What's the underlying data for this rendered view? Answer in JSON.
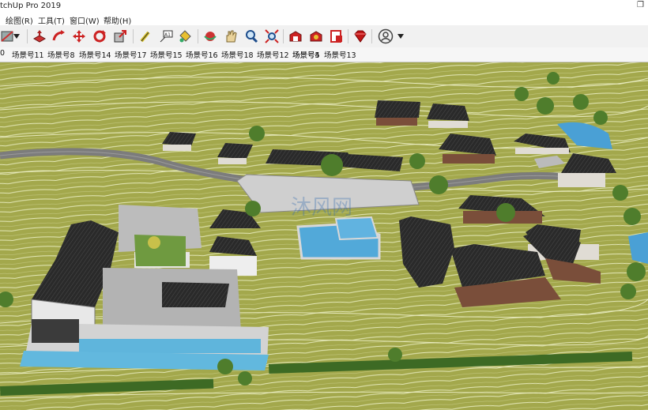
{
  "window": {
    "title": "tchUp Pro 2019",
    "restore_glyph": "❐"
  },
  "menu": {
    "items": [
      "绘图(R)",
      "工具(T)",
      "窗口(W)",
      "帮助(H)"
    ]
  },
  "toolbar": {
    "icons": [
      "paint-icon",
      "dropdown-arrow-icon",
      "push-pull-icon",
      "follow-me-icon",
      "move-icon",
      "rotate-icon",
      "scale-icon",
      "tape-measure-icon",
      "text-icon",
      "paint-bucket-icon",
      "orbit-icon",
      "pan-icon",
      "zoom-icon",
      "zoom-extents-icon",
      "warehouse-icon",
      "extension-warehouse-icon",
      "layout-icon",
      "ruby-icon",
      "account-icon",
      "account-dropdown-icon"
    ]
  },
  "scenes": {
    "tabs": [
      "0",
      "场景号11",
      "场景号8",
      "场景号14",
      "场景号17",
      "场景号15",
      "场景号16",
      "场景号18",
      "场景号12",
      "场景号5",
      "场景号4",
      "场景号13"
    ]
  },
  "viewport": {
    "watermark": "沐风网",
    "accent_colors": {
      "grass": "#a3a84c",
      "roof": "#2a2a2a",
      "pool": "#52a9d9",
      "road": "#7c7c7c",
      "tree": "#4f7d2c"
    }
  }
}
